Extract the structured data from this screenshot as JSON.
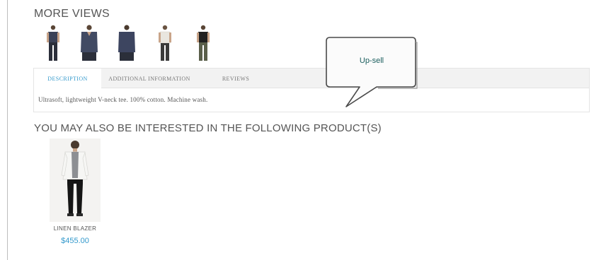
{
  "more_views": {
    "title": "MORE VIEWS",
    "thumbnails": [
      {
        "icon": "model-navy-tee-front-icon",
        "shirt_color": "#3b4257",
        "pants_color": "#2b2f3a"
      },
      {
        "icon": "model-navy-tee-closeup-icon",
        "shirt_color": "#414a63",
        "pants_color": "#2b2f3a"
      },
      {
        "icon": "model-navy-tee-back-icon",
        "shirt_color": "#3d4560",
        "pants_color": "#2b2f3a"
      },
      {
        "icon": "model-white-tee-icon",
        "shirt_color": "#e9e6df",
        "pants_color": "#3a3a3a"
      },
      {
        "icon": "model-black-tee-icon",
        "shirt_color": "#202020",
        "pants_color": "#5a5f4a"
      }
    ]
  },
  "tabs": {
    "items": [
      {
        "label": "DESCRIPTION",
        "active": true
      },
      {
        "label": "ADDITIONAL INFORMATION",
        "active": false
      },
      {
        "label": "REVIEWS",
        "active": false
      }
    ],
    "content": "Ultrasoft, lightweight V-neck tee. 100% cotton. Machine wash."
  },
  "callout": {
    "label": "Up-sell"
  },
  "upsell": {
    "title": "YOU MAY ALSO BE INTERESTED IN THE FOLLOWING PRODUCT(S)",
    "products": [
      {
        "name": "LINEN BLAZER",
        "price": "$455.00",
        "icon": "model-white-blazer-icon"
      }
    ]
  },
  "colors": {
    "accent": "#3399cc",
    "text": "#555555",
    "callout_text": "#1b5e5e"
  }
}
